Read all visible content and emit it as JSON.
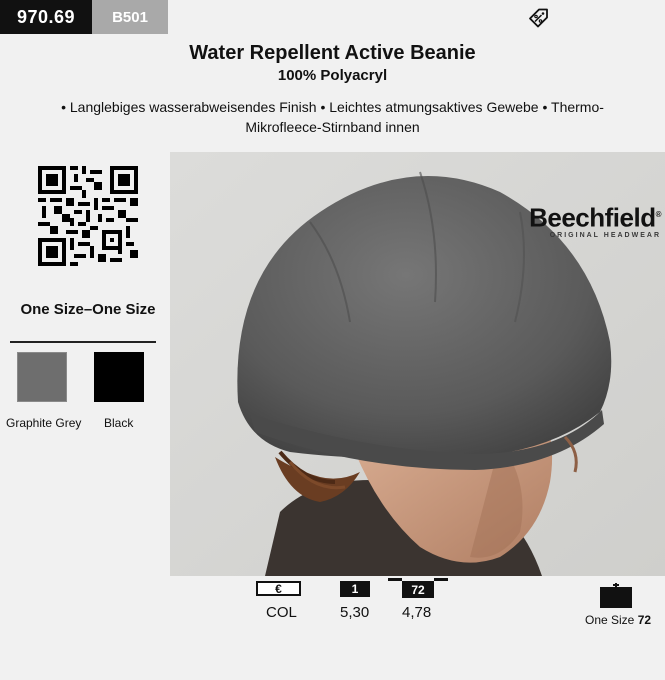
{
  "header": {
    "article_number": "970.69",
    "model_code": "B501",
    "tag_icon": "discount-tag-icon"
  },
  "product": {
    "title": "Water Repellent Active Beanie",
    "material": "100% Polyacryl",
    "features": "• Langlebiges wasserabweisendes Finish • Leichtes atmungsaktives Gewebe • Thermo-Mikrofleece-Stirnband innen"
  },
  "sizes": {
    "label": "One Size–One Size"
  },
  "colors": [
    {
      "name": "Graphite Grey",
      "hex": "#6e6e6e"
    },
    {
      "name": "Black",
      "hex": "#000000"
    }
  ],
  "brand": {
    "name": "Beechfield",
    "registered": "®",
    "tagline": "ORIGINAL HEADWEAR"
  },
  "pricing": {
    "currency_symbol": "€",
    "col_label": "COL",
    "qty_1_label": "1",
    "qty_72_label": "72",
    "price_1": "5,30",
    "price_72": "4,78"
  },
  "packaging": {
    "size_text": "One Size",
    "quantity": "72"
  }
}
